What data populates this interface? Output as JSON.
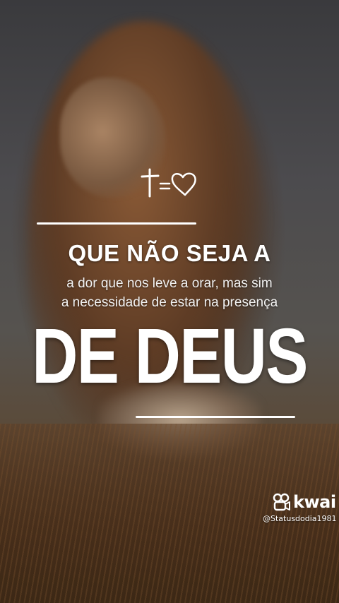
{
  "background": {
    "subject": "lion-photo",
    "colors": {
      "sky": "#4c4b4e",
      "mane": "#8a5a36",
      "grass": "#5c3e26"
    }
  },
  "symbol": {
    "icon": "cross-equals-heart-icon"
  },
  "text": {
    "headline": "QUE NÃO SEJA A",
    "line_1": "a dor que nos leve a orar, mas sim",
    "line_2": "a necessidade  de estar na presença",
    "big_title": "DE DEUS"
  },
  "watermark": {
    "brand": "kwai",
    "handle": "@Statusdodia1981",
    "icon": "kwai-logo-icon"
  }
}
